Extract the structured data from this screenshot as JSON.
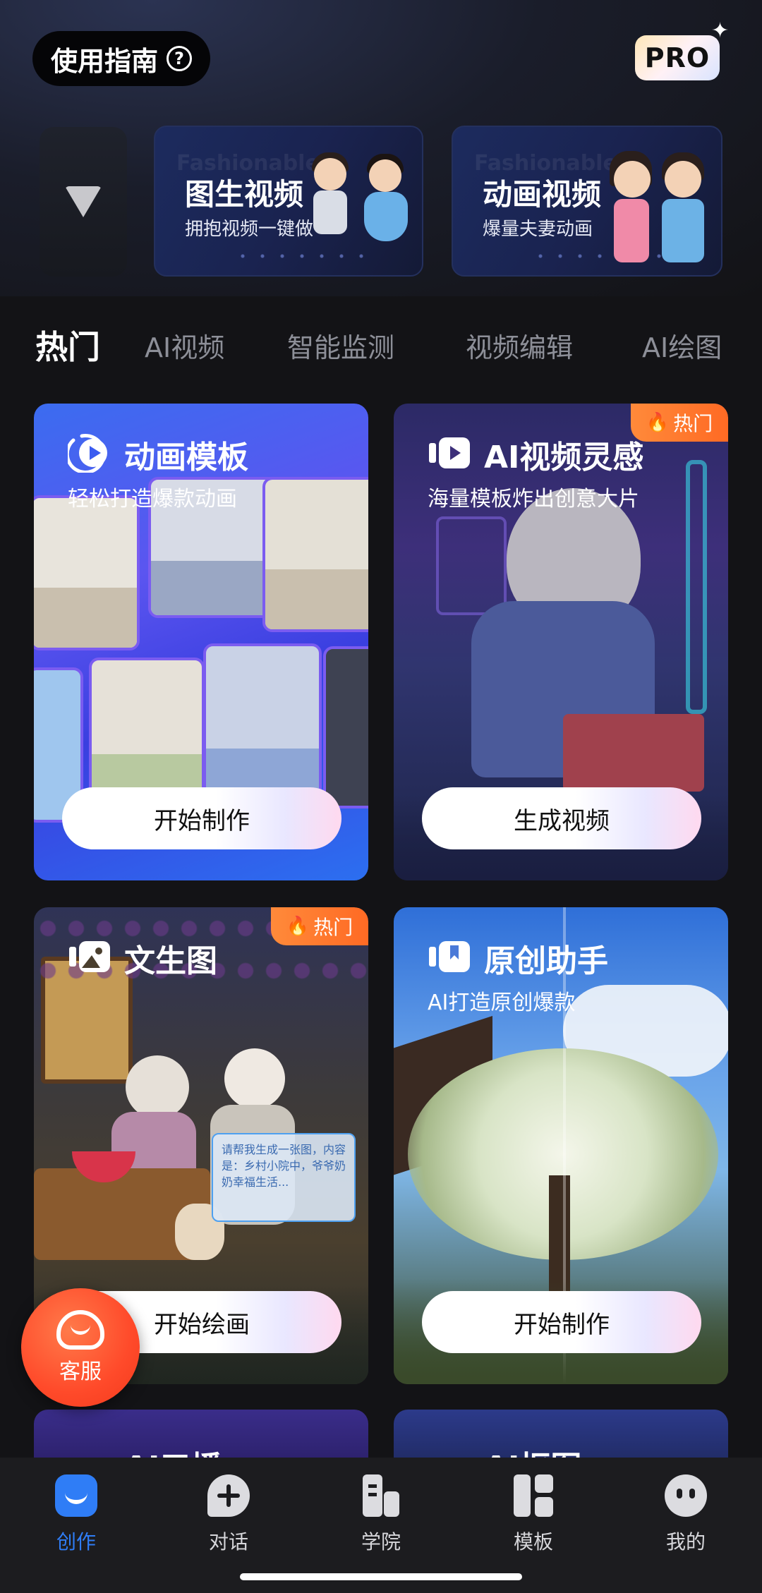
{
  "header": {
    "guide_label": "使用指南",
    "guide_icon": "question-circle-icon",
    "pro_label": "PRO"
  },
  "banners": [
    {
      "title": "图生视频",
      "subtitle": "拥抱视频一键做",
      "watermark": "Fashionable"
    },
    {
      "title": "动画视频",
      "subtitle": "爆量夫妻动画",
      "watermark": "Fashionable"
    }
  ],
  "tabs": [
    {
      "label": "热门",
      "active": true
    },
    {
      "label": "AI视频"
    },
    {
      "label": "智能监测"
    },
    {
      "label": "视频编辑"
    },
    {
      "label": "AI绘图"
    }
  ],
  "cards": [
    {
      "title": "动画模板",
      "subtitle": "轻松打造爆款动画",
      "action": "开始制作",
      "hot": false
    },
    {
      "title": "AI视频灵感",
      "subtitle": "海量模板炸出创意大片",
      "action": "生成视频",
      "hot": true
    },
    {
      "title": "文生图",
      "subtitle": "",
      "action": "开始绘画",
      "hot": true,
      "prompt_bubble": "请帮我生成一张图，内容是：乡村小院中，爷爷奶奶幸福生活..."
    },
    {
      "title": "原创助手",
      "subtitle": "AI打造原创爆款",
      "action": "开始制作",
      "hot": false
    },
    {
      "title": "AI口播"
    },
    {
      "title": "AI抠图"
    }
  ],
  "hot_label": "热门",
  "service": {
    "label": "客服"
  },
  "bottom_nav": [
    {
      "label": "创作",
      "icon": "create-icon",
      "active": true
    },
    {
      "label": "对话",
      "icon": "chat-plus-icon"
    },
    {
      "label": "学院",
      "icon": "academy-icon"
    },
    {
      "label": "模板",
      "icon": "template-grid-icon"
    },
    {
      "label": "我的",
      "icon": "profile-face-icon"
    }
  ],
  "colors": {
    "accent": "#2f7df6",
    "hot": "#ff6a24",
    "service": "#ff4a2a"
  }
}
